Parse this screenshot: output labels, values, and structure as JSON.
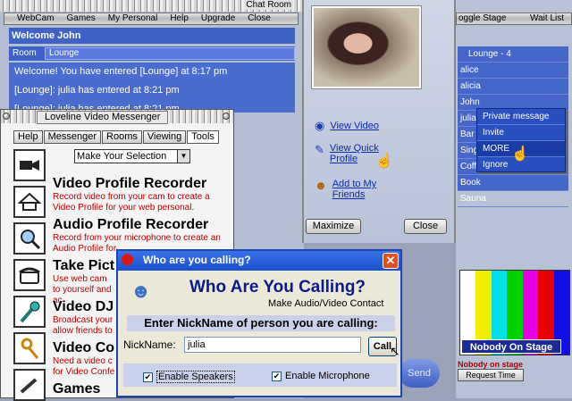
{
  "chat_window": {
    "title": "Chat Room",
    "menu": [
      "WebCam",
      "Games",
      "My Personal",
      "Help",
      "Upgrade",
      "Close"
    ],
    "welcome": "Welcome John",
    "room_label": "Room",
    "room_value": "Lounge",
    "messages": [
      "Welcome! You have entered [Lounge] at 8:17 pm",
      "[Lounge]: julia has entered at 8:21 pm",
      "[Lounge]: julia has entered at 8:21 pm"
    ]
  },
  "video_panel": {
    "links": [
      "View Video",
      "View Quick Profile",
      "Add to My Friends"
    ],
    "maximize": "Maximize",
    "close": "Close"
  },
  "stage": {
    "menu": [
      "oggle Stage",
      "Wait List"
    ],
    "room_header": "Lounge - 4",
    "users": [
      "alice",
      "alicia",
      "John",
      "julia",
      "Bar",
      "Sing",
      "Coff",
      "Book",
      "Sauna"
    ],
    "nobody": "Nobody On Stage",
    "status": "Nobody on stage",
    "request": "Request Time",
    "send": "Send"
  },
  "context_menu": {
    "items": [
      "Private message",
      "Invite",
      "MORE",
      "Ignore"
    ]
  },
  "messenger": {
    "title": "Loveline Video Messenger",
    "tabs": [
      "Help",
      "Messenger",
      "Rooms",
      "Viewing",
      "Tools"
    ],
    "select_value": "Make Your Selection",
    "items": [
      {
        "title": "Video Profile Recorder",
        "desc": "Record video from your cam to create a Video Profile for your web personal."
      },
      {
        "title": "Audio Profile Recorder",
        "desc": "Record from your microphone to create an Audio Profile for"
      },
      {
        "title": "Take Pict",
        "desc": "Use web cam to yourself and ac"
      },
      {
        "title": "Video DJ",
        "desc": "Broadcast your allow friends to"
      },
      {
        "title": "Video Co",
        "desc": "Need a video c for Video Confe"
      },
      {
        "title": "Games",
        "desc": ""
      }
    ]
  },
  "dialog": {
    "title": "Who are you calling?",
    "heading": "Who Are You Calling?",
    "subheading": "Make Audio/Video Contact",
    "prompt": "Enter NickName of person you are calling:",
    "nick_label": "NickName:",
    "nick_value": "julia",
    "call": "Call",
    "speakers": "Enable Speakers",
    "microphone": "Enable Microphone"
  }
}
